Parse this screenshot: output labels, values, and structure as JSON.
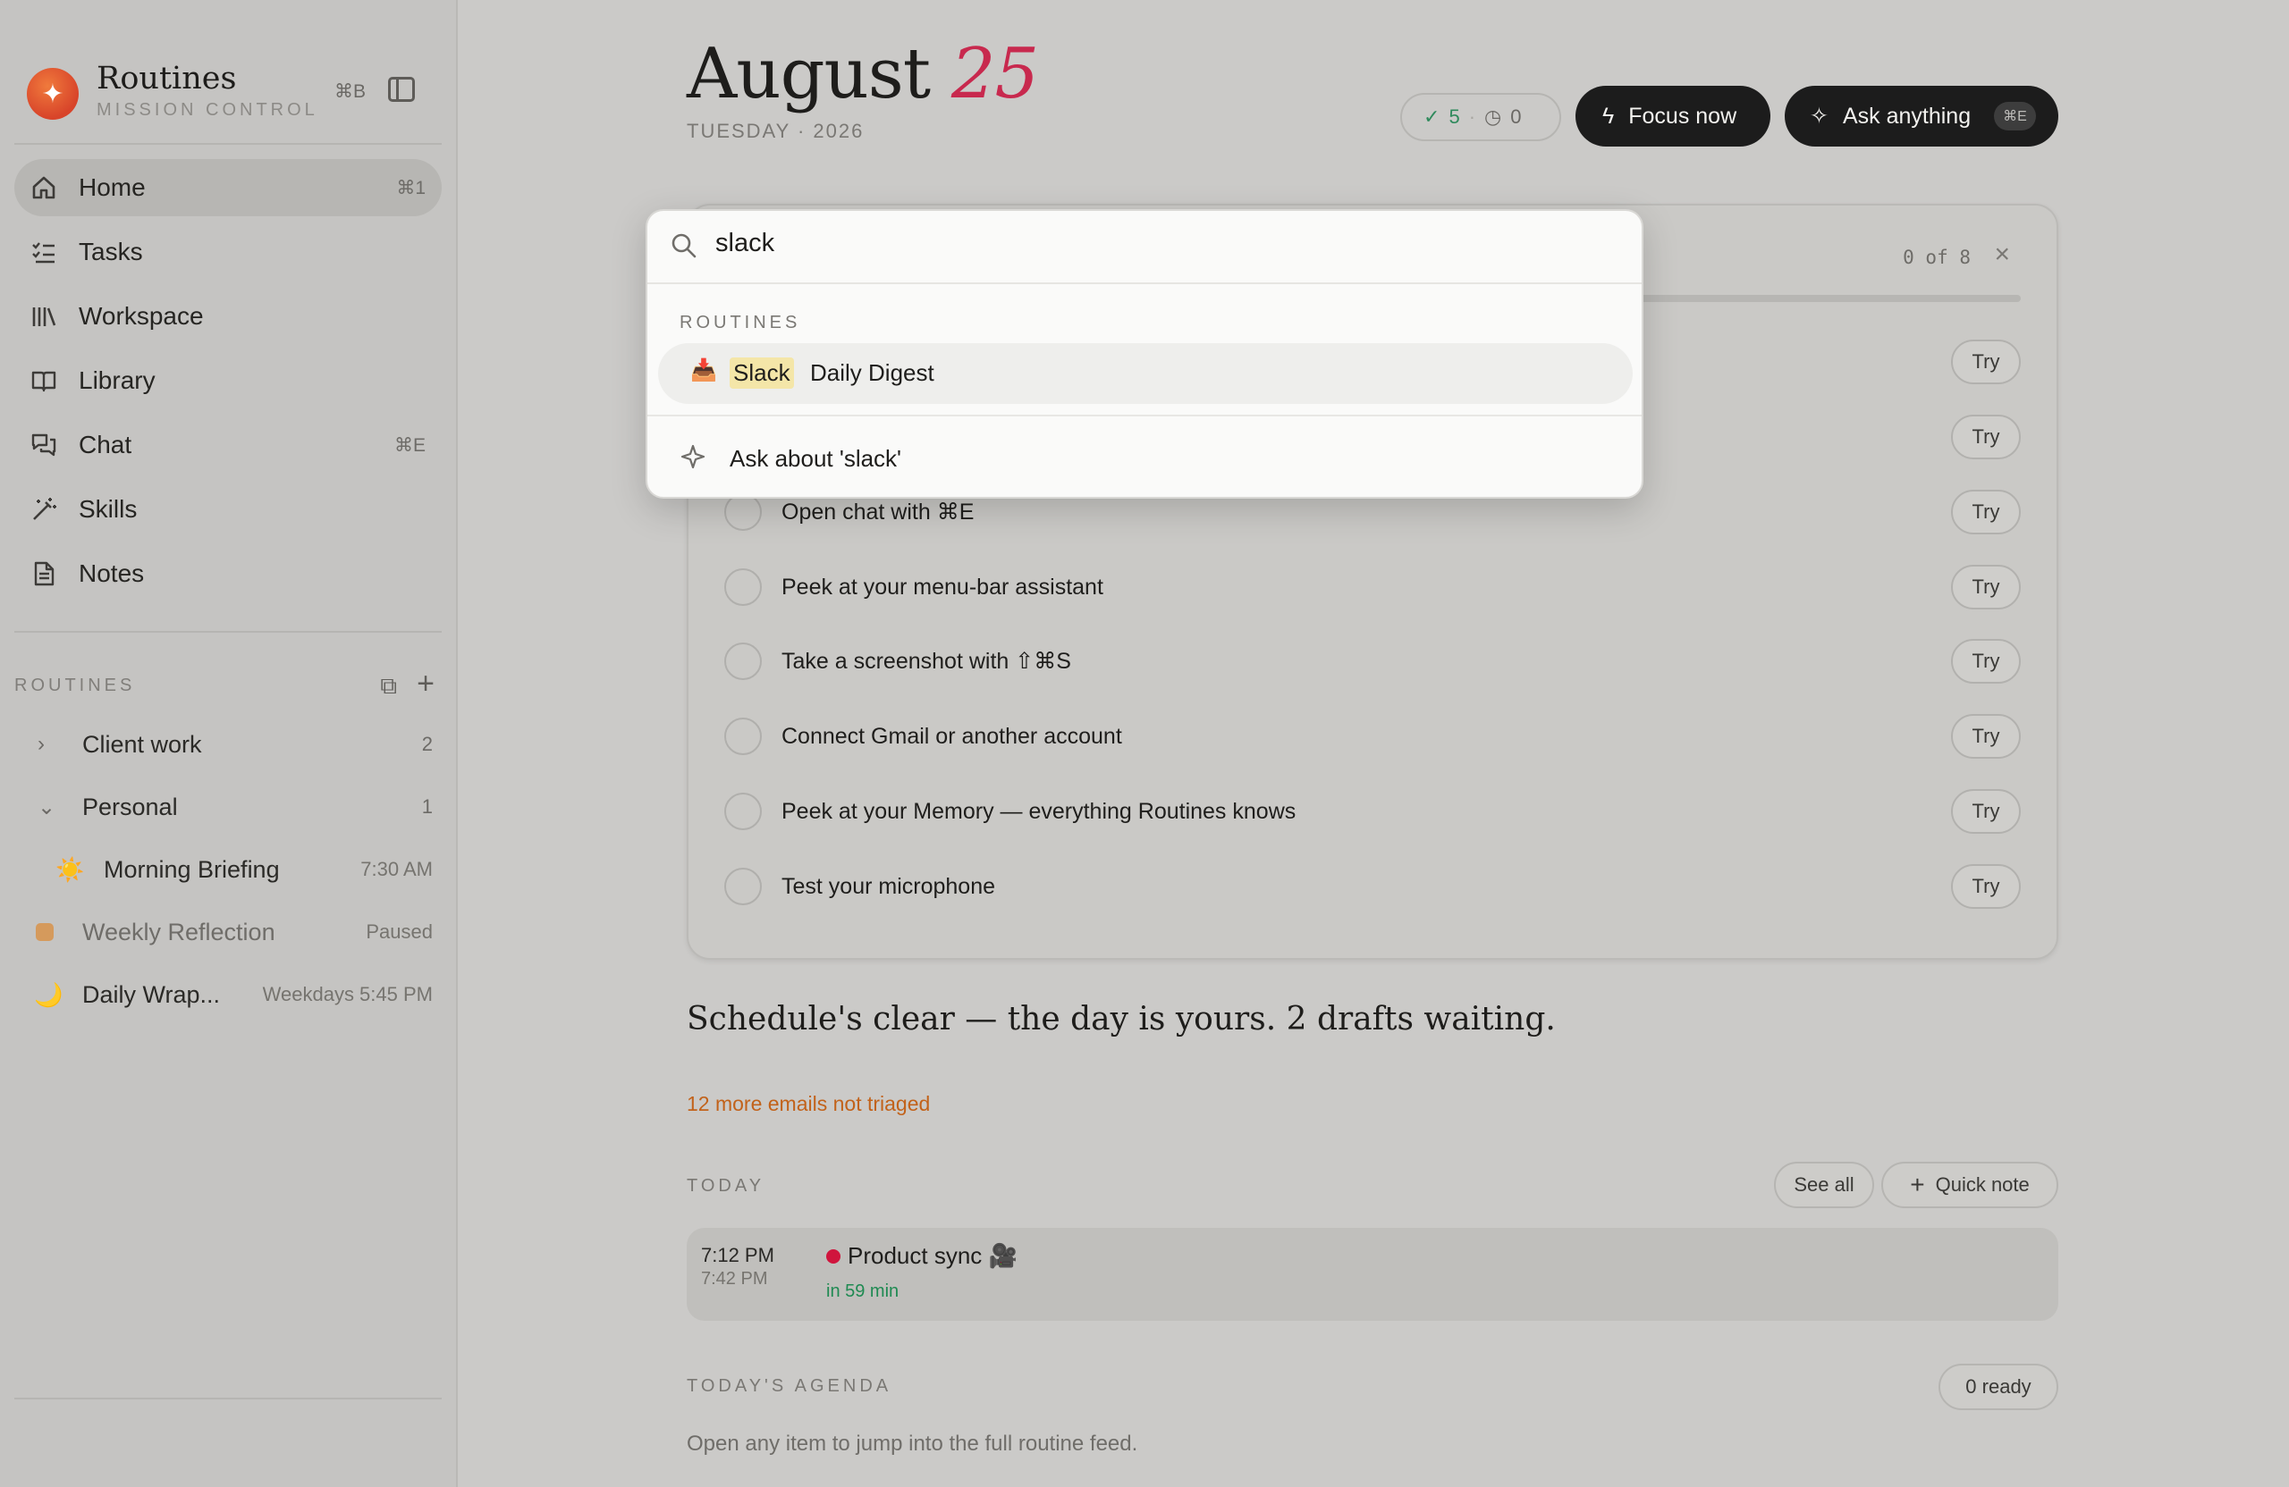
{
  "sidebar": {
    "brand": {
      "title": "Routines",
      "subtitle": "MISSION CONTROL",
      "shortcut": "⌘B"
    },
    "nav": [
      {
        "label": "Home",
        "shortcut": "⌘1",
        "icon": "home-icon"
      },
      {
        "label": "Tasks",
        "shortcut": "",
        "icon": "checklist-icon"
      },
      {
        "label": "Workspace",
        "shortcut": "",
        "icon": "library-shelf-icon"
      },
      {
        "label": "Library",
        "shortcut": "",
        "icon": "book-icon"
      },
      {
        "label": "Chat",
        "shortcut": "⌘E",
        "icon": "chat-icon"
      },
      {
        "label": "Skills",
        "shortcut": "",
        "icon": "magic-wand-icon"
      },
      {
        "label": "Notes",
        "shortcut": "",
        "icon": "document-icon"
      }
    ],
    "routines_label": "ROUTINES",
    "groups": [
      {
        "label": "Client work",
        "count": "2"
      },
      {
        "label": "Personal",
        "count": "1"
      }
    ],
    "routines": [
      {
        "label": "Morning Briefing",
        "time": "7:30 AM",
        "icon": "☀️"
      },
      {
        "label": "Weekly Reflection",
        "time": "Paused",
        "icon": "🟧"
      },
      {
        "label": "Daily Wrap...",
        "time": "Weekdays 5:45 PM",
        "icon": "🌙"
      }
    ]
  },
  "header": {
    "month": "August",
    "day": "25",
    "subtitle": "TUESDAY · 2026",
    "stats_done": "5",
    "stats_pending": "0",
    "focus_label": "Focus now",
    "ask_label": "Ask anything",
    "ask_shortcut": "⌘E"
  },
  "checklist": {
    "count": "0 of 8",
    "try_label": "Try",
    "tasks": [
      {
        "label": ""
      },
      {
        "label": ""
      },
      {
        "label": "Open chat with ⌘E"
      },
      {
        "label": "Peek at your menu-bar assistant"
      },
      {
        "label": "Take a screenshot with ⇧⌘S"
      },
      {
        "label": "Connect Gmail or another account"
      },
      {
        "label": "Peek at your Memory — everything Routines knows"
      },
      {
        "label": "Test your microphone"
      }
    ]
  },
  "summary": {
    "schedule": "Schedule's clear — the day is yours. 2 drafts waiting.",
    "triage": "12 more emails not triaged"
  },
  "today": {
    "label": "TODAY",
    "see_all": "See all",
    "quick_note": "Quick note",
    "event": {
      "start": "7:12 PM",
      "end": "7:42 PM",
      "title": "Product sync 🎥",
      "relative": "in 59 min"
    }
  },
  "agenda": {
    "label": "TODAY'S AGENDA",
    "ready": "0 ready",
    "hint": "Open any item to jump into the full routine feed."
  },
  "palette": {
    "query": "slack",
    "section": "ROUTINES",
    "result_highlight": "Slack",
    "result_rest": "Daily Digest",
    "result_emoji": "📥",
    "ask_label": "Ask about 'slack'"
  },
  "colors": {
    "accent": "#c8294e",
    "brand": "#d8442a",
    "success": "#2f8a5c",
    "warning": "#c2621a",
    "highlight": "#f4e6a8"
  }
}
